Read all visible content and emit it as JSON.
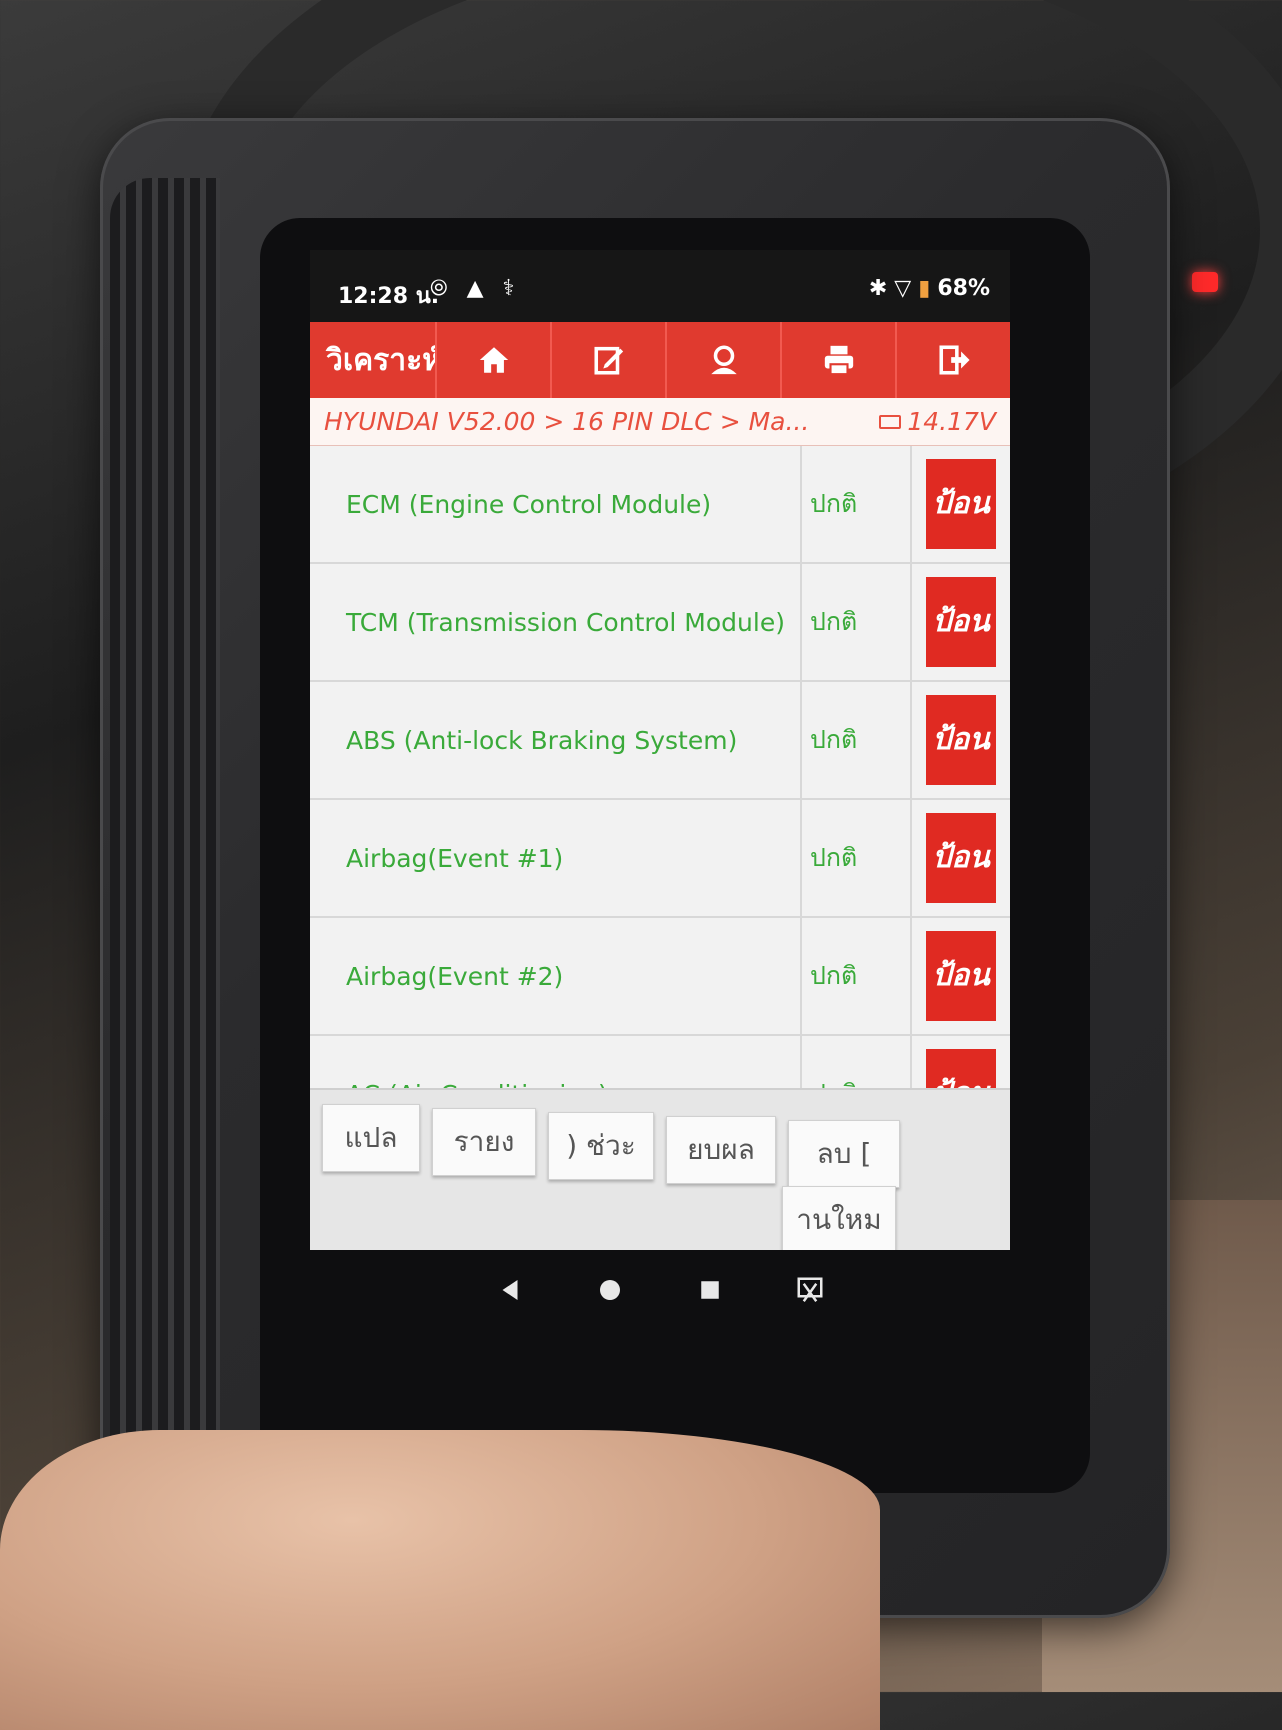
{
  "status_bar": {
    "time": "12:28 น.",
    "battery": "68%"
  },
  "toolbar": {
    "title": "วิเคราะห์",
    "buttons": [
      {
        "name": "home",
        "icon": "home-icon"
      },
      {
        "name": "edit",
        "icon": "edit-icon"
      },
      {
        "name": "support",
        "icon": "user-support-icon"
      },
      {
        "name": "print",
        "icon": "printer-icon"
      },
      {
        "name": "exit",
        "icon": "exit-icon"
      }
    ]
  },
  "breadcrumb": {
    "path": "HYUNDAI V52.00 > 16 PIN DLC > Ma...",
    "voltage": "14.17V"
  },
  "modules": [
    {
      "name": "ECM (Engine Control Module)",
      "status": "ปกติ",
      "action": "ป้อน"
    },
    {
      "name": "TCM (Transmission Control Module)",
      "status": "ปกติ",
      "action": "ป้อน"
    },
    {
      "name": "ABS (Anti-lock Braking System)",
      "status": "ปกติ",
      "action": "ป้อน"
    },
    {
      "name": "Airbag(Event #1)",
      "status": "ปกติ",
      "action": "ป้อน"
    },
    {
      "name": "Airbag(Event #2)",
      "status": "ปกติ",
      "action": "ป้อน"
    },
    {
      "name": "AC (Air Conditioning)",
      "status": "ปกติ",
      "action": "ป้อน"
    }
  ],
  "bottom_buttons": [
    {
      "label": "แปล"
    },
    {
      "label": "รายง"
    },
    {
      "label": ") ช่วะ"
    },
    {
      "label": "ยบผล"
    },
    {
      "label": "ลบ ["
    },
    {
      "label": "านใหม"
    }
  ],
  "colors": {
    "accent_red": "#e03a2f",
    "status_green": "#3aaa3a"
  }
}
